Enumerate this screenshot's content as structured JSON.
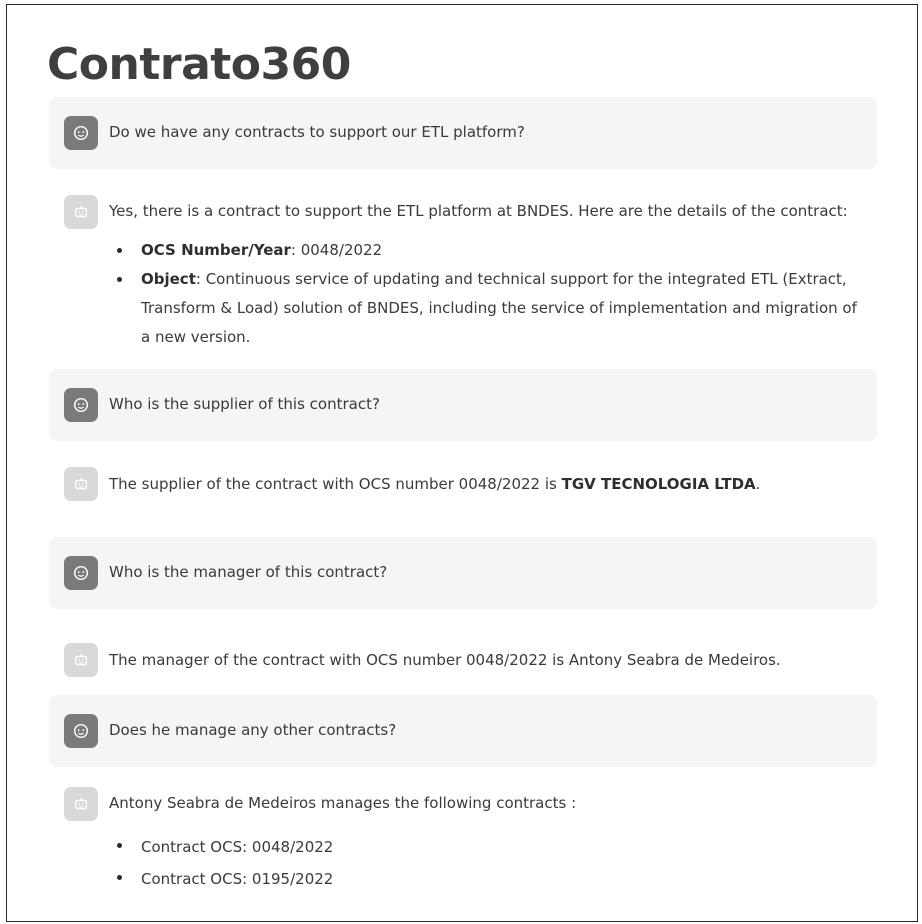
{
  "app": {
    "title": "Contrato360"
  },
  "conversation": {
    "q1": {
      "text": "Do we have any contracts to support our ETL platform?"
    },
    "a1": {
      "intro": "Yes, there is a contract to support the ETL platform at BNDES. Here are the details of the contract:",
      "items": [
        {
          "label": "OCS Number/Year",
          "value": ": 0048/2022"
        },
        {
          "label": "Object",
          "value": ": Continuous service of updating and technical support for the integrated ETL (Extract, Transform & Load) solution of BNDES, including the service of implementation and migration of a new version."
        }
      ]
    },
    "q2": {
      "text": "Who is the supplier of this contract?"
    },
    "a2": {
      "prefix": "The supplier of the contract with OCS number 0048/2022 is ",
      "supplier": "TGV TECNOLOGIA LTDA",
      "suffix": "."
    },
    "q3": {
      "text": "Who is the manager of this contract?"
    },
    "a3": {
      "text": "The manager of the contract with OCS number 0048/2022 is Antony Seabra de Medeiros."
    },
    "q4": {
      "text": "Does he manage any other contracts?"
    },
    "a4": {
      "intro": "Antony Seabra de Medeiros manages the following contracts :",
      "items": [
        "Contract OCS: 0048/2022",
        "Contract OCS: 0195/2022"
      ]
    }
  },
  "icons": {
    "user": "user-face-icon",
    "assistant": "robot-icon"
  }
}
